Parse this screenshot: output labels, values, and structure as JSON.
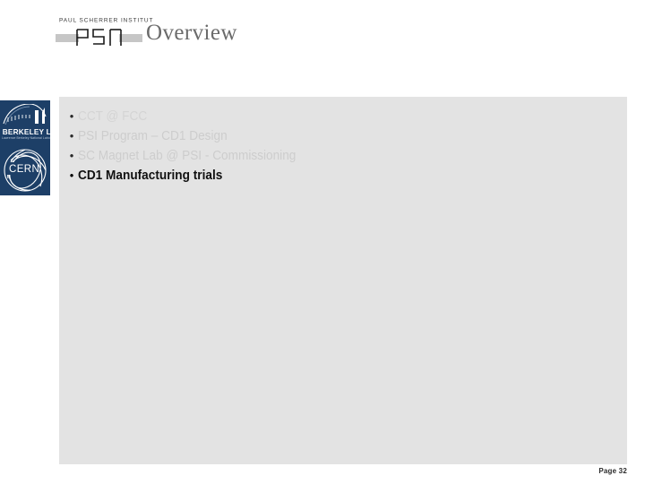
{
  "header": {
    "title": "Overview",
    "psi_logo": {
      "wordmark": "PAUL SCHERRER INSTITUT",
      "mark_label": "PSI"
    }
  },
  "left_logos": {
    "berkeley": {
      "name": "BERKELEY LAB",
      "tagline": "Lawrence Berkeley National Laboratory"
    },
    "cern": {
      "name": "CERN"
    }
  },
  "content": {
    "bullets": [
      {
        "text": "CCT @ FCC",
        "state": "dim1"
      },
      {
        "text": "PSI Program – CD1 Design",
        "state": "dim2"
      },
      {
        "text": "SC Magnet Lab @ PSI - Commissioning",
        "state": "dim3"
      },
      {
        "text": "CD1 Manufacturing trials",
        "state": "active"
      }
    ],
    "bullet_glyph": "•"
  },
  "footer": {
    "page_label": "Page 32"
  },
  "colors": {
    "navy": "#1d3f67",
    "content_bg": "#e3e3e3",
    "title_gray": "#6b6b6b",
    "dim_text": "#cdcdcd",
    "active_text": "#111111"
  }
}
